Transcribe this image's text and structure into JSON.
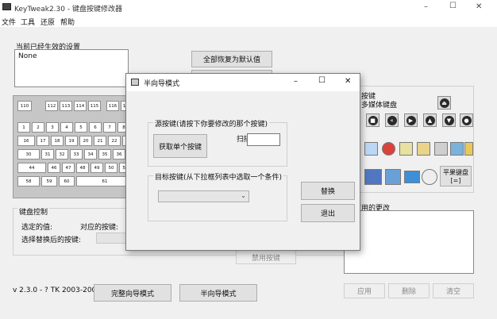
{
  "window": {
    "app_title": "KeyTweak2.30 - 键盘按键修改器",
    "controls": {
      "minimize": "–",
      "maximize": "☐",
      "close": "✕"
    }
  },
  "menu": [
    "文件",
    "工具",
    "还原",
    "帮助"
  ],
  "current_settings": {
    "label": "当前已经生效的设置",
    "value": "None"
  },
  "buttons": {
    "restore_all": "全部恢复为默认值",
    "full_wizard": "完整向导模式",
    "half_wizard": "半向导模式",
    "disable_key": "禁用按键",
    "apply": "应用",
    "remove": "删除",
    "clear": "清空"
  },
  "right_panel": {
    "line1": "按键",
    "line2": "多媒体键盘",
    "pc_keyboard": "平果键盘",
    "pc_keyboard_sub": "[=]"
  },
  "keyboard_rows": [
    [
      "110",
      "112",
      "113",
      "114",
      "115",
      "116",
      "117"
    ],
    [
      "1",
      "2",
      "3",
      "4",
      "5",
      "6",
      "7",
      "8"
    ],
    [
      "16",
      "17",
      "18",
      "19",
      "20",
      "21",
      "22",
      "23"
    ],
    [
      "30",
      "31",
      "32",
      "33",
      "34",
      "35",
      "36"
    ],
    [
      "44",
      "46",
      "47",
      "48",
      "49",
      "50",
      "51"
    ],
    [
      "58",
      "59",
      "60",
      "61"
    ]
  ],
  "keyboard_control": {
    "title": "键盘控制",
    "selected_value": "选定的值:",
    "mapped_key": "对应的按键:",
    "choose_replacement": "选择替换后的按键:"
  },
  "pending": {
    "title": "应用的更改"
  },
  "version": "v 2.3.0 - ? TK 2003-2009",
  "dialog": {
    "title": "半向导模式",
    "controls": {
      "minimize": "–",
      "maximize": "☐",
      "close": "✕"
    },
    "source_group": "源按键(请按下你要修改的那个按键)",
    "get_key_button": "获取单个按键",
    "scan_code_label": "扫描码:",
    "target_group": "目标按键(从下拉框列表中选取一个条件)",
    "swap_button": "替换",
    "exit_button": "退出"
  }
}
